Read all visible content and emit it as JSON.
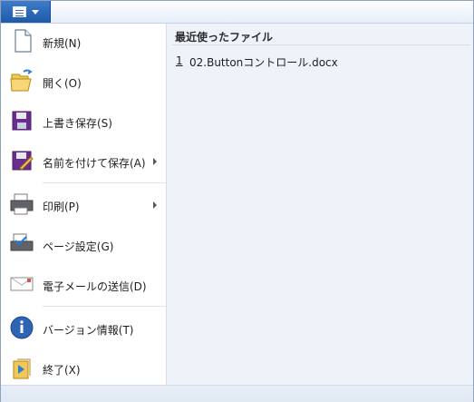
{
  "menu": {
    "items": [
      {
        "label": "新規(N)",
        "icon": "document-icon"
      },
      {
        "label": "開く(O)",
        "icon": "folder-open-icon"
      },
      {
        "label": "上書き保存(S)",
        "icon": "save-icon"
      },
      {
        "label": "名前を付けて保存(A)",
        "icon": "save-as-icon",
        "has_submenu": true
      },
      {
        "label": "印刷(P)",
        "icon": "printer-icon",
        "has_submenu": true
      },
      {
        "label": "ページ設定(G)",
        "icon": "page-setup-icon"
      },
      {
        "label": "電子メールの送信(D)",
        "icon": "mail-icon"
      },
      {
        "label": "バージョン情報(T)",
        "icon": "info-icon"
      },
      {
        "label": "終了(X)",
        "icon": "exit-icon"
      }
    ]
  },
  "recent": {
    "title": "最近使ったファイル",
    "items": [
      {
        "index": "1",
        "name": "02.Buttonコントロール.docx"
      }
    ]
  },
  "colors": {
    "app_button": "#2a67b6",
    "right_pane": "#eef3fa",
    "border": "#8da2bd"
  }
}
